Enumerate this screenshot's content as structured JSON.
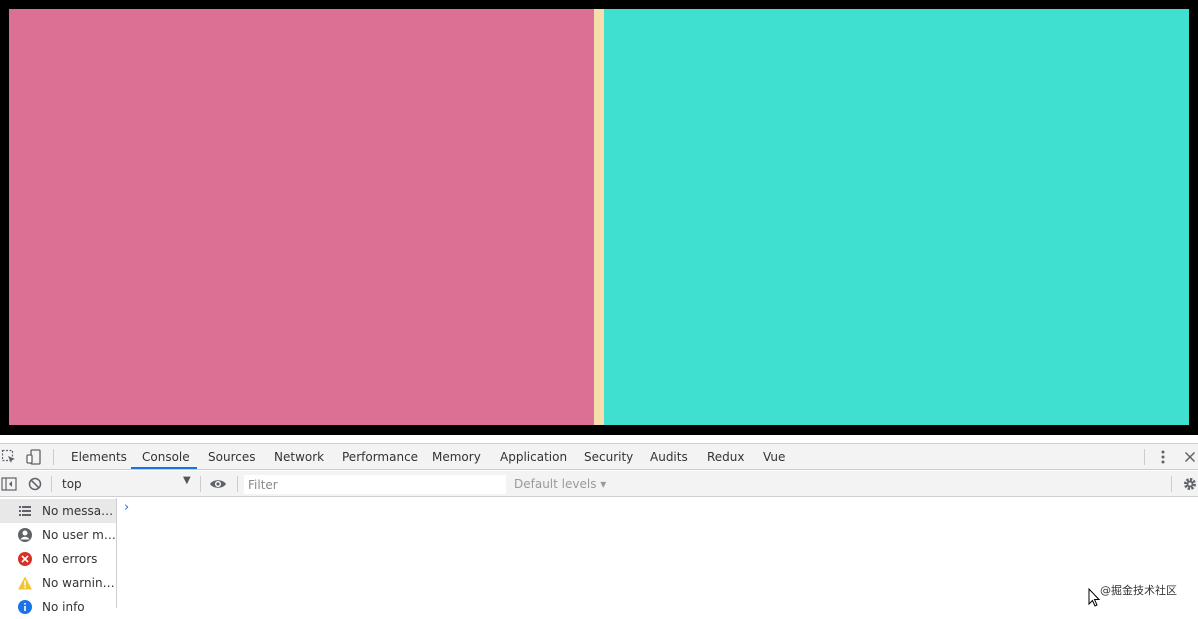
{
  "viewport": {
    "panel_left_color": "#dc6f94",
    "gutter_color": "#f5deab",
    "panel_right_color": "#40e0d0",
    "frame_color": "#000000"
  },
  "devtools": {
    "tabs": [
      {
        "label": "Elements",
        "active": false
      },
      {
        "label": "Console",
        "active": true
      },
      {
        "label": "Sources",
        "active": false
      },
      {
        "label": "Network",
        "active": false
      },
      {
        "label": "Performance",
        "active": false
      },
      {
        "label": "Memory",
        "active": false
      },
      {
        "label": "Application",
        "active": false
      },
      {
        "label": "Security",
        "active": false
      },
      {
        "label": "Audits",
        "active": false
      },
      {
        "label": "Redux",
        "active": false
      },
      {
        "label": "Vue",
        "active": false
      }
    ],
    "accent_color": "#1a73e8",
    "toolbar": {
      "context": "top",
      "filter_placeholder": "Filter",
      "levels": "Default levels ▾"
    },
    "sidebar": [
      {
        "label": "No messages",
        "icon": "list-icon"
      },
      {
        "label": "No user me...",
        "icon": "user-icon"
      },
      {
        "label": "No errors",
        "icon": "error-icon"
      },
      {
        "label": "No warnings",
        "icon": "warning-icon"
      },
      {
        "label": "No info",
        "icon": "info-icon"
      }
    ],
    "prompt_symbol": "›"
  },
  "watermark": "@掘金技术社区"
}
